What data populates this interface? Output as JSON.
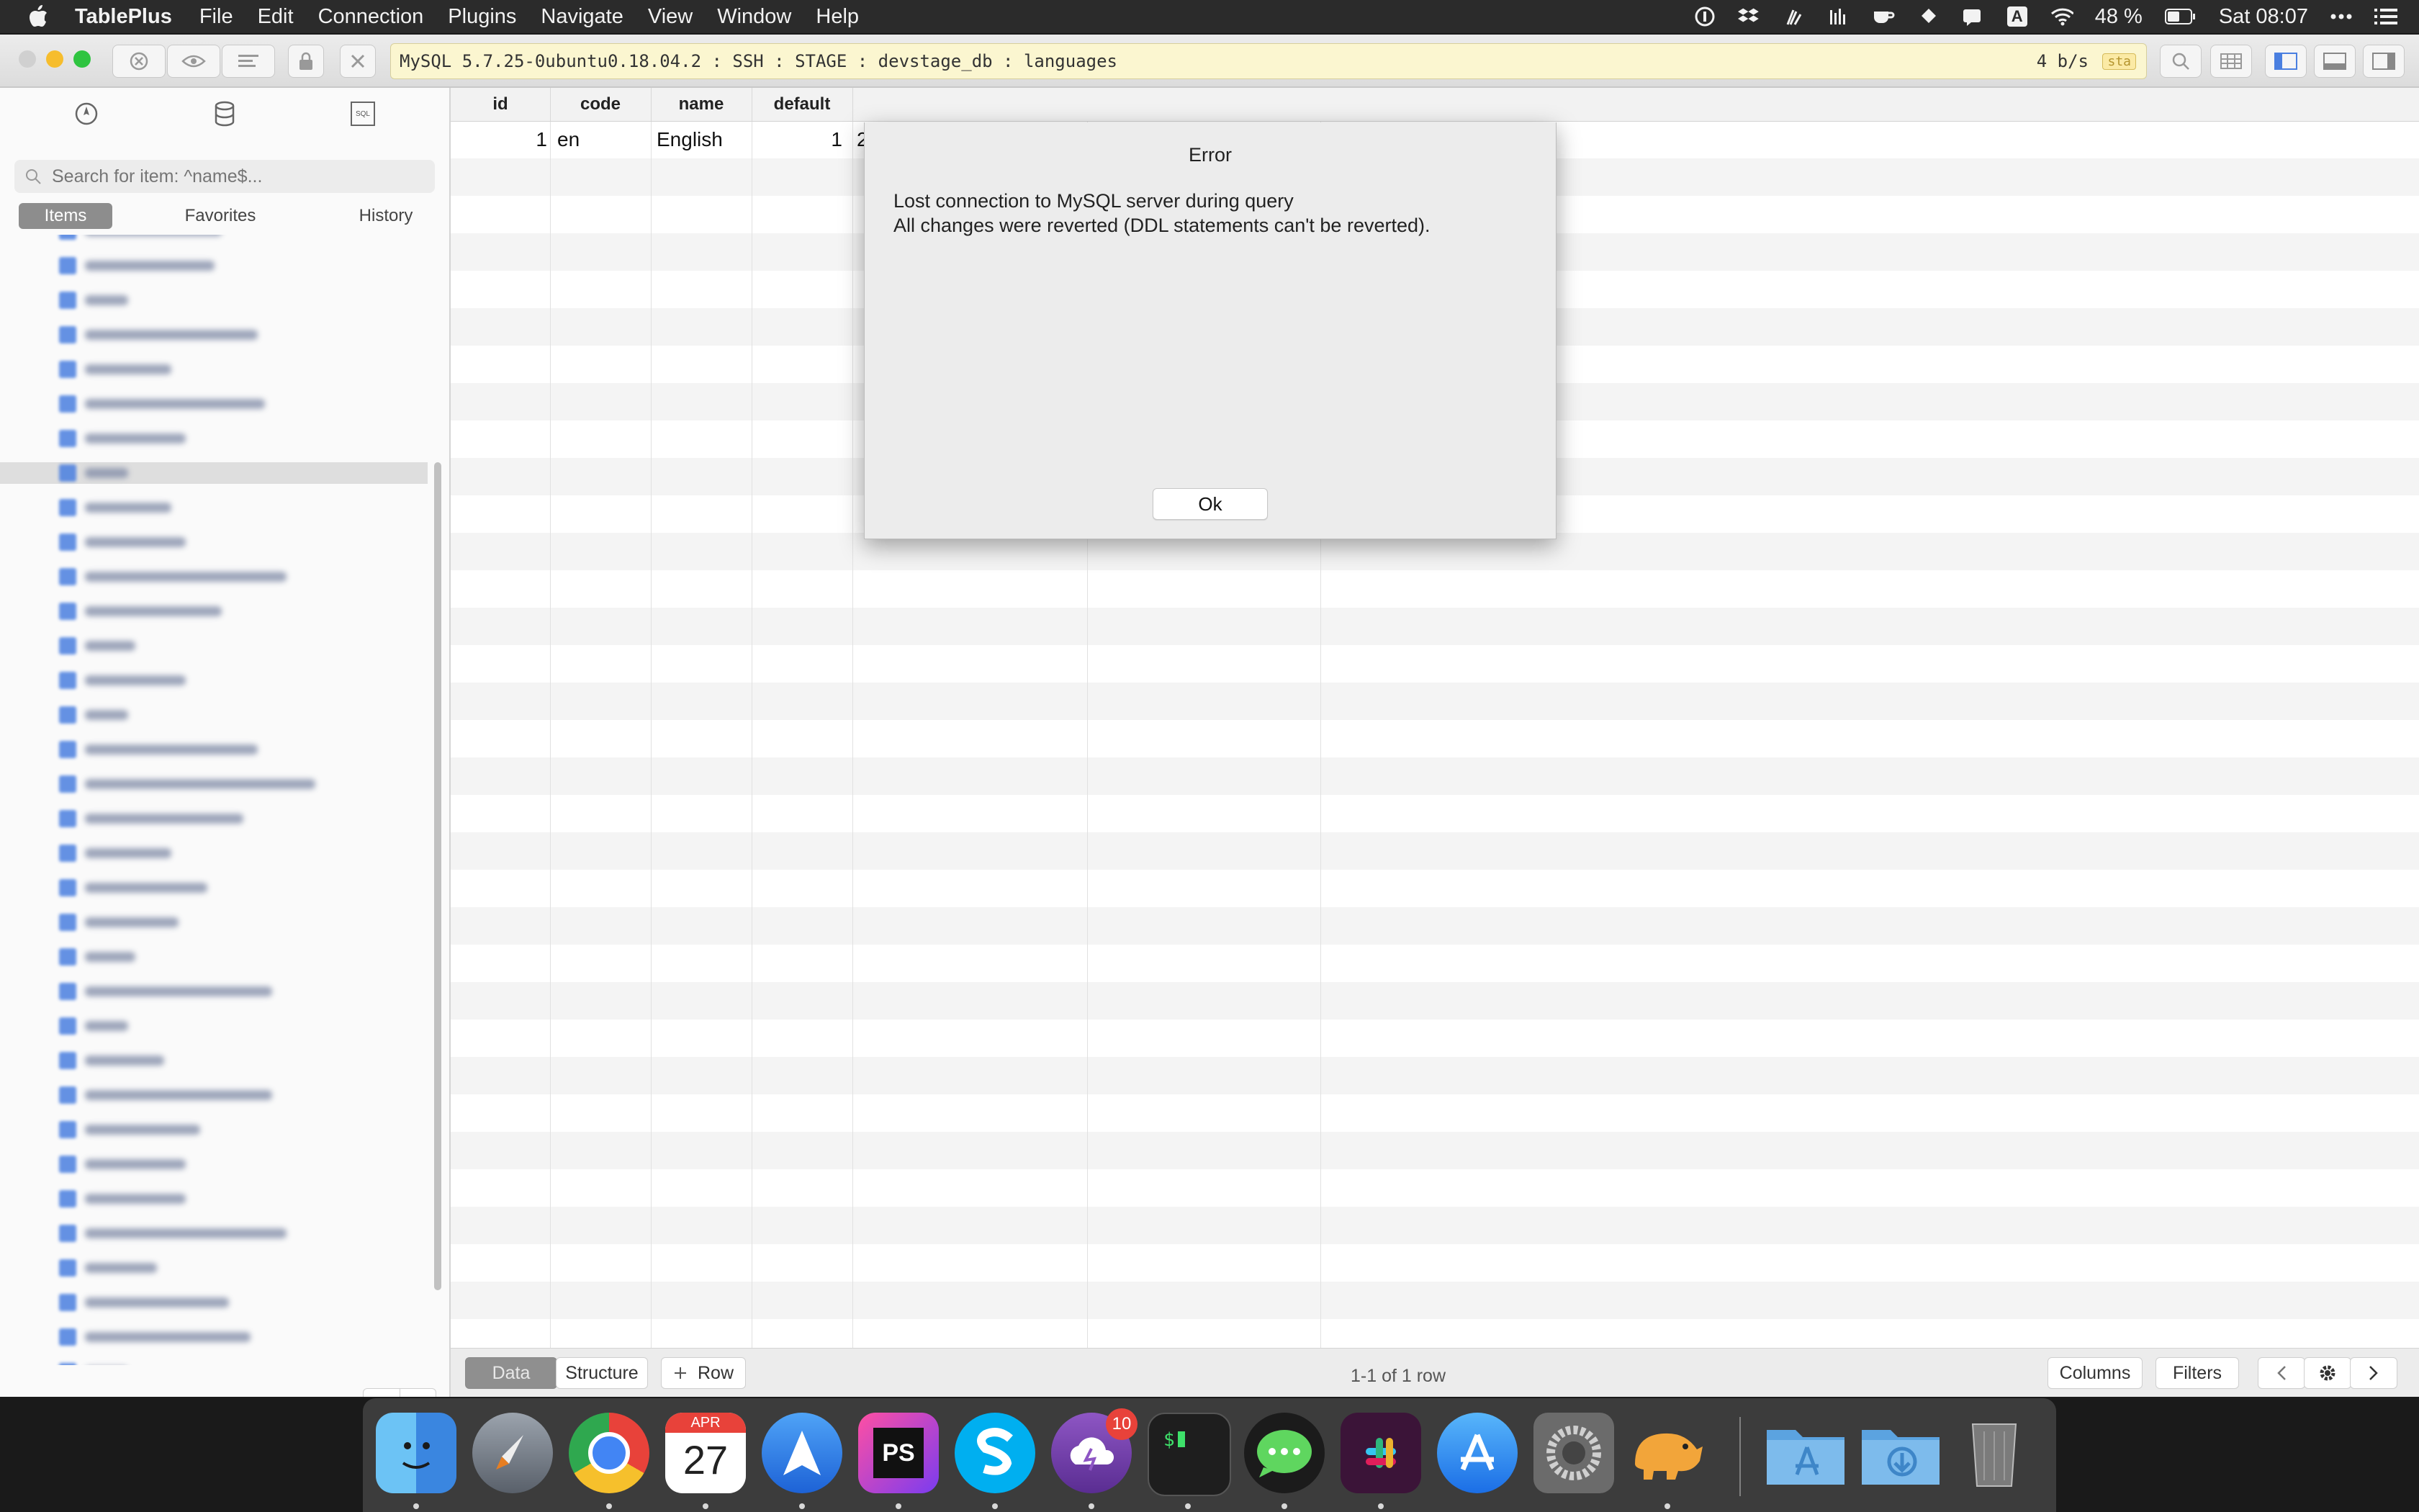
{
  "menubar": {
    "app_name": "TablePlus",
    "items": [
      "File",
      "Edit",
      "Connection",
      "Plugins",
      "Navigate",
      "View",
      "Window",
      "Help"
    ],
    "battery": "48 %",
    "clock": "Sat 08:07",
    "input_source": "A"
  },
  "toolbar": {
    "connection_info": "MySQL 5.7.25-0ubuntu0.18.04.2 : SSH : STAGE : devstage_db : languages",
    "rate": "4 b/s",
    "env_tag": "sta"
  },
  "sidebar": {
    "search_placeholder": "Search for item: ^name$...",
    "segments": [
      "Items",
      "Favorites",
      "History"
    ],
    "active_segment": "Items",
    "sql_icon_label": "SQL"
  },
  "grid": {
    "columns": [
      "id",
      "code",
      "name",
      "default"
    ],
    "rows": [
      {
        "id": "1",
        "code": "en",
        "name": "English",
        "default": "1",
        "extra": "2"
      }
    ]
  },
  "bottombar": {
    "data_tab": "Data",
    "structure_tab": "Structure",
    "add_row": "Row",
    "row_count": "1-1 of 1 row",
    "columns_btn": "Columns",
    "filters_btn": "Filters"
  },
  "dialog": {
    "title": "Error",
    "message_line1": "Lost connection to MySQL server during query",
    "message_line2": "All changes were reverted (DDL statements can't be reverted).",
    "ok_label": "Ok"
  },
  "dock": {
    "calendar_month": "APR",
    "calendar_day": "27",
    "badge_count": "10",
    "phpstorm_label": "PS"
  }
}
